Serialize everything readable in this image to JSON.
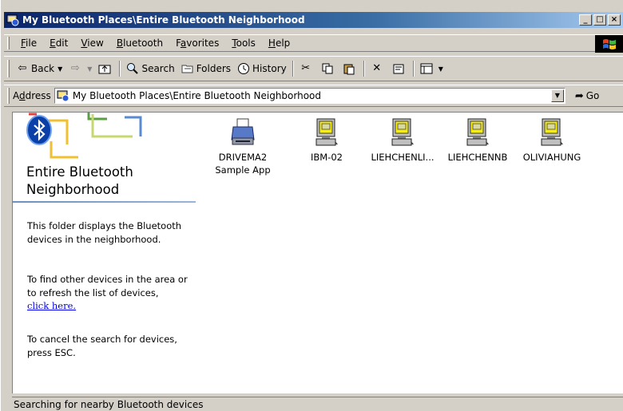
{
  "window": {
    "title": "My Bluetooth Places\\Entire Bluetooth Neighborhood",
    "controls": {
      "minimize": "_",
      "maximize": "□",
      "close": "×"
    }
  },
  "menubar": {
    "items": [
      {
        "label": "File",
        "accel": "F",
        "rest": "ile"
      },
      {
        "label": "Edit",
        "accel": "E",
        "rest": "dit"
      },
      {
        "label": "View",
        "accel": "V",
        "rest": "iew"
      },
      {
        "label": "Bluetooth",
        "accel": "B",
        "rest": "luetooth"
      },
      {
        "label": "Favorites",
        "accel": "a",
        "pre": "F",
        "rest": "vorites"
      },
      {
        "label": "Tools",
        "accel": "T",
        "rest": "ools"
      },
      {
        "label": "Help",
        "accel": "H",
        "rest": "elp"
      }
    ]
  },
  "toolbar": {
    "back": "Back",
    "search": "Search",
    "folders": "Folders",
    "history": "History"
  },
  "address": {
    "label_accel": "d",
    "label_pre": "A",
    "label_rest": "dress",
    "value": "My Bluetooth Places\\Entire Bluetooth Neighborhood",
    "go": "Go"
  },
  "panel": {
    "title": "Entire Bluetooth Neighborhood",
    "desc": "This folder displays the Bluetooth devices in the neighborhood.",
    "refresh": "To find other devices in the area or to refresh the list of devices,",
    "link": "click here.",
    "cancel": "To cancel the search for devices, press ESC."
  },
  "devices": [
    {
      "name": "DRIVEMA2 Sample App",
      "icon": "printer-icon"
    },
    {
      "name": "IBM-02",
      "icon": "computer-icon"
    },
    {
      "name": "LIEHCHENLI...",
      "icon": "computer-icon"
    },
    {
      "name": "LIEHCHENNB",
      "icon": "computer-icon"
    },
    {
      "name": "OLIVIAHUNG",
      "icon": "computer-icon"
    }
  ],
  "status": "Searching for nearby Bluetooth devices",
  "colors": {
    "title_start": "#0a246a",
    "title_end": "#a6caf0",
    "face": "#d4d0c8",
    "link": "#0000ee",
    "bluetooth": "#0a3fa8"
  }
}
